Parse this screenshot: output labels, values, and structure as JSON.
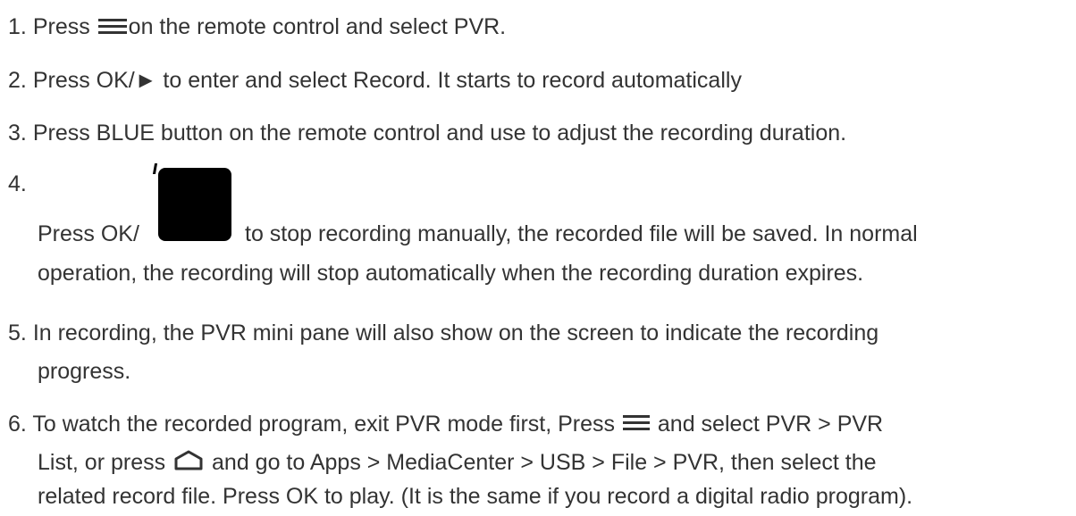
{
  "steps": [
    {
      "number": "1.",
      "parts": {
        "a": "Press ",
        "b": "on the remote control and select PVR."
      }
    },
    {
      "number": "2.",
      "text": "Press OK/►  to enter and select Record. It starts to record automatically"
    },
    {
      "number": "3.",
      "text": "Press BLUE button on the remote control and use to adjust the recording duration."
    },
    {
      "number": "4.",
      "parts": {
        "a": "Press OK/",
        "b": "to stop recording manually, the recorded file will be saved. In normal",
        "c": "operation, the recording will stop automatically when the recording duration expires."
      }
    },
    {
      "number": "5.",
      "lines": [
        "In recording, the PVR mini pane will also show on the screen to indicate the recording",
        "progress."
      ]
    },
    {
      "number": "6.",
      "parts": {
        "a": "To watch the recorded program, exit PVR mode first, Press ",
        "b": " and select PVR > PVR",
        "c": "List, or press ",
        "d": " and go to Apps > MediaCenter > USB > File > PVR, then select the",
        "e": "related record file. Press OK to play. (It is the same if you record a digital radio program)."
      }
    }
  ],
  "icons": {
    "menu": "menu-icon",
    "home": "home-icon",
    "stop": "stop-icon"
  }
}
